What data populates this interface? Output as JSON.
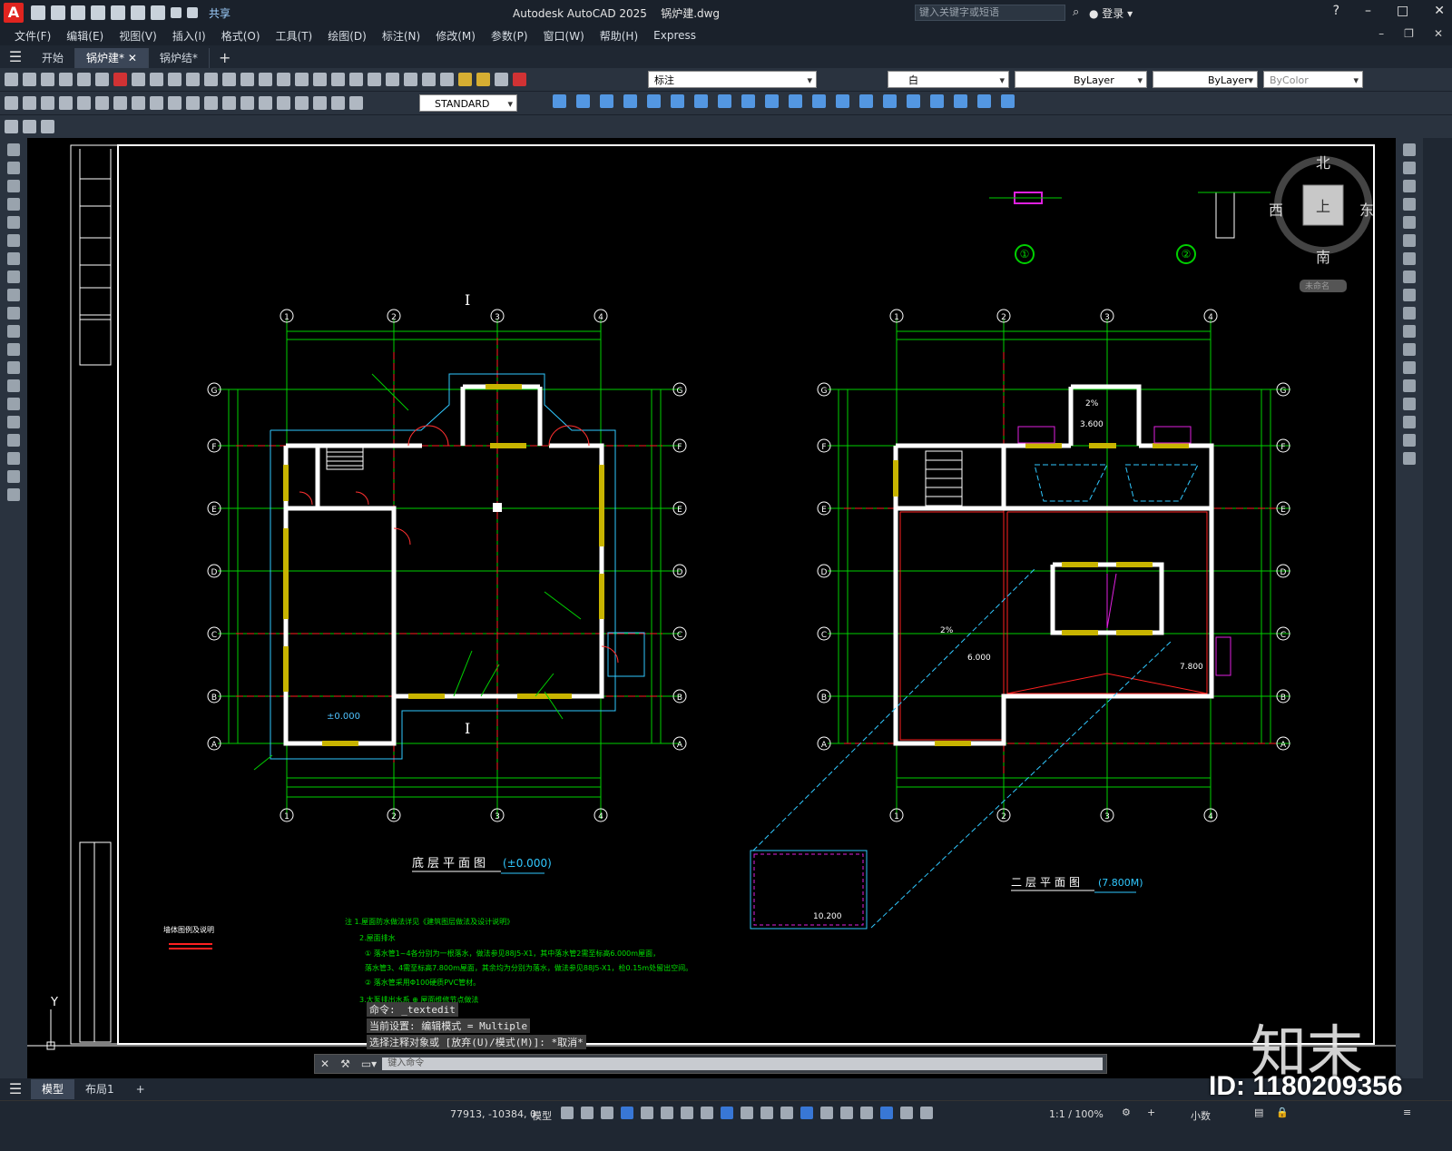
{
  "app": {
    "logo": "A",
    "title": "Autodesk AutoCAD 2025",
    "filename": "锅炉建.dwg",
    "share_label": "共享",
    "search_placeholder": "键入关键字或短语",
    "login_label": "登录"
  },
  "menu": [
    "文件(F)",
    "编辑(E)",
    "视图(V)",
    "插入(I)",
    "格式(O)",
    "工具(T)",
    "绘图(D)",
    "标注(N)",
    "修改(M)",
    "参数(P)",
    "窗口(W)",
    "帮助(H)",
    "Express"
  ],
  "file_tabs": [
    "开始",
    "锅炉建*",
    "锅炉结*"
  ],
  "layer_combo": "标注",
  "color_combo": "白",
  "linetype_combo": "ByLayer",
  "lineweight_combo": "ByLayer",
  "plotstyle_combo": "ByColor",
  "textstyle_combo": "STANDARD",
  "viewcube": {
    "north": "北",
    "south": "南",
    "east": "东",
    "west": "西",
    "top": "上",
    "wcs": "未命名"
  },
  "drawing": {
    "plan1_title": "底层平面图",
    "plan1_level": "(±0.000)",
    "plan2_title": "二层平面图",
    "plan2_level": "(7.800M)",
    "section_mark": "I",
    "detail_1": "①",
    "detail_2": "②",
    "grid_cols": [
      "1",
      "2",
      "3",
      "4"
    ],
    "grid_rows": [
      "G",
      "F",
      "E",
      "D",
      "C",
      "B",
      "A"
    ],
    "level_0": "±0.000",
    "level_6": "6.000",
    "level_78": "7.800",
    "level_36": "3.600",
    "level_102": "10.200",
    "slope": "2%",
    "legend_title": "墙体图例及说明",
    "notes": [
      "注  1.屋面防水做法详见《建筑图层做法及设计说明》",
      "2.屋面排水",
      "①  落水管1~4各分别为一根落水，做法参见88J5-X1，其中落水管2需至标高6.000m屋面，",
      "    落水管3、4需至标高7.800m屋面，其余均为分别为落水，做法参见88J5-X1，检0.15m处留出空间。",
      "②  落水管采用Φ100硬质PVC管材。",
      "3.大泵排出水系 ⊕  屋面维修节点做法"
    ]
  },
  "command": {
    "history": [
      "命令: _textedit",
      "当前设置: 编辑模式 = Multiple",
      "选择注释对象或 [放弃(U)/模式(M)]: *取消*"
    ],
    "placeholder": "键入命令"
  },
  "layout_tabs": [
    "模型",
    "布局1"
  ],
  "status": {
    "coords": "77913, -10384, 0",
    "model": "模型",
    "scale": "1:1 / 100%",
    "units": "小数"
  },
  "watermark": {
    "site": "知末",
    "id": "ID: 1180209356"
  }
}
